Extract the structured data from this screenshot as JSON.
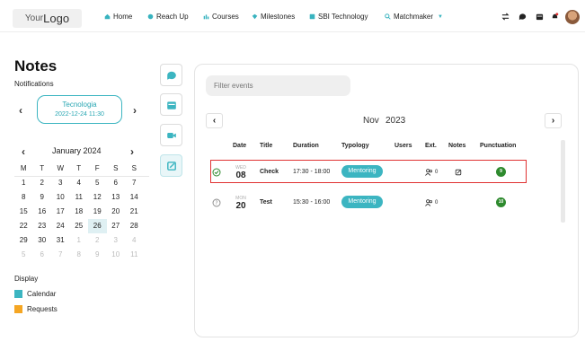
{
  "logo": {
    "prefix": "Your",
    "main": "Logo"
  },
  "nav": [
    {
      "label": "Home",
      "icon": "home-icon"
    },
    {
      "label": "Reach Up",
      "icon": "reach-up-icon"
    },
    {
      "label": "Courses",
      "icon": "courses-icon"
    },
    {
      "label": "Milestones",
      "icon": "milestones-icon"
    },
    {
      "label": "SBI Technology",
      "icon": "sbi-technology-icon"
    },
    {
      "label": "Matchmaker",
      "icon": "search-icon"
    }
  ],
  "page": {
    "title": "Notes"
  },
  "notifications": {
    "label": "Notifications",
    "card_title": "Tecnologia",
    "card_datetime": "2022-12-24 11:30"
  },
  "calendar": {
    "title": "January 2024",
    "weekdays": [
      "M",
      "T",
      "W",
      "T",
      "F",
      "S",
      "S"
    ],
    "weeks": [
      [
        "1",
        "2",
        "3",
        "4",
        "5",
        "6",
        "7"
      ],
      [
        "8",
        "9",
        "10",
        "11",
        "12",
        "13",
        "14"
      ],
      [
        "15",
        "16",
        "17",
        "18",
        "19",
        "20",
        "21"
      ],
      [
        "22",
        "23",
        "24",
        "25",
        "26",
        "27",
        "28"
      ],
      [
        "29",
        "30",
        "31",
        "1",
        "2",
        "3",
        "4"
      ],
      [
        "5",
        "6",
        "7",
        "8",
        "9",
        "10",
        "11"
      ]
    ],
    "today": "26"
  },
  "display": {
    "label": "Display",
    "legend": [
      {
        "label": "Calendar",
        "color": "#3cb5c1"
      },
      {
        "label": "Requests",
        "color": "#f5a623"
      }
    ]
  },
  "events": {
    "filter_placeholder": "Filter events",
    "month": "Nov",
    "year": "2023",
    "columns": [
      "Date",
      "Title",
      "Duration",
      "Typology",
      "Users",
      "Ext.",
      "Notes",
      "Punctuation"
    ],
    "rows": [
      {
        "weekday": "WED",
        "day": "08",
        "title": "Check",
        "duration": "17:30 - 18:00",
        "typology": "Mentoring",
        "ext": "0",
        "score": "9",
        "status": "done"
      },
      {
        "weekday": "MON",
        "day": "20",
        "title": "Test",
        "duration": "15:30 - 16:00",
        "typology": "Mentoring",
        "ext": "0",
        "score": "10",
        "status": "pending"
      }
    ]
  },
  "colors": {
    "accent": "#3cb5c1",
    "highlight": "#e03232",
    "score": "#2e8a2e"
  }
}
